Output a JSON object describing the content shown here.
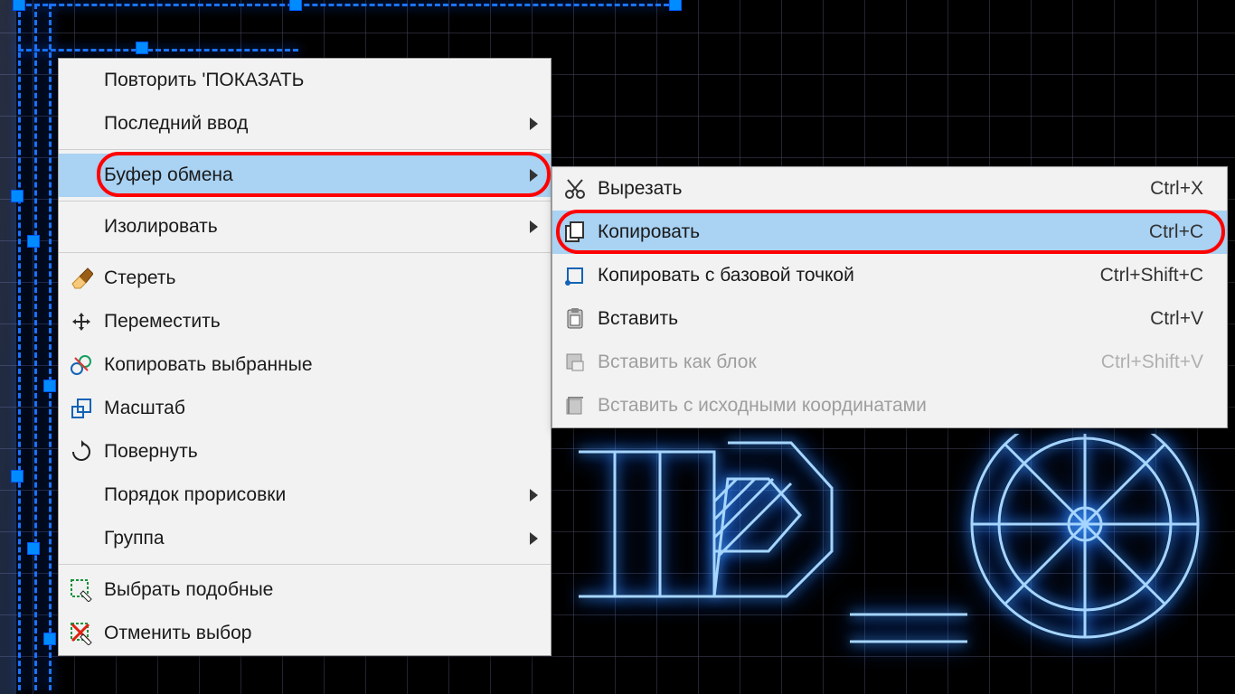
{
  "main_menu": {
    "items": [
      {
        "name": "repeat",
        "label": "Повторить 'ПОКАЗАТЬ",
        "sub": false,
        "icon": ""
      },
      {
        "name": "recent-input",
        "label": "Последний ввод",
        "sub": true,
        "icon": ""
      },
      {
        "sep": true
      },
      {
        "name": "clipboard",
        "label": "Буфер обмена",
        "sub": true,
        "icon": "",
        "highlight": true,
        "callout": true
      },
      {
        "sep": true
      },
      {
        "name": "isolate",
        "label": "Изолировать",
        "sub": true,
        "icon": ""
      },
      {
        "sep": true
      },
      {
        "name": "erase",
        "label": "Стереть",
        "sub": false,
        "icon": "erase"
      },
      {
        "name": "move",
        "label": "Переместить",
        "sub": false,
        "icon": "move"
      },
      {
        "name": "copy-selected",
        "label": "Копировать выбранные",
        "sub": false,
        "icon": "copysel"
      },
      {
        "name": "scale",
        "label": "Масштаб",
        "sub": false,
        "icon": "scale"
      },
      {
        "name": "rotate",
        "label": "Повернуть",
        "sub": false,
        "icon": "rotate"
      },
      {
        "name": "draw-order",
        "label": "Порядок прорисовки",
        "sub": true,
        "icon": ""
      },
      {
        "name": "group",
        "label": "Группа",
        "sub": true,
        "icon": ""
      },
      {
        "sep": true
      },
      {
        "name": "select-similar",
        "label": "Выбрать подобные",
        "sub": false,
        "icon": "selsim"
      },
      {
        "name": "deselect",
        "label": "Отменить выбор",
        "sub": false,
        "icon": "desel"
      }
    ]
  },
  "sub_menu": {
    "items": [
      {
        "name": "cut",
        "label": "Вырезать",
        "shortcut": "Ctrl+X",
        "icon": "cut",
        "disabled": false
      },
      {
        "name": "copy",
        "label": "Копировать",
        "shortcut": "Ctrl+C",
        "icon": "copy",
        "disabled": false,
        "highlight": true,
        "callout": true
      },
      {
        "name": "copy-base",
        "label": "Копировать с базовой точкой",
        "shortcut": "Ctrl+Shift+C",
        "icon": "copybase",
        "disabled": false
      },
      {
        "name": "paste",
        "label": "Вставить",
        "shortcut": "Ctrl+V",
        "icon": "paste",
        "disabled": false
      },
      {
        "name": "paste-block",
        "label": "Вставить как блок",
        "shortcut": "Ctrl+Shift+V",
        "icon": "pasteblk",
        "disabled": true
      },
      {
        "name": "paste-original",
        "label": "Вставить с исходными координатами",
        "shortcut": "",
        "icon": "pasteorig",
        "disabled": true
      }
    ]
  }
}
